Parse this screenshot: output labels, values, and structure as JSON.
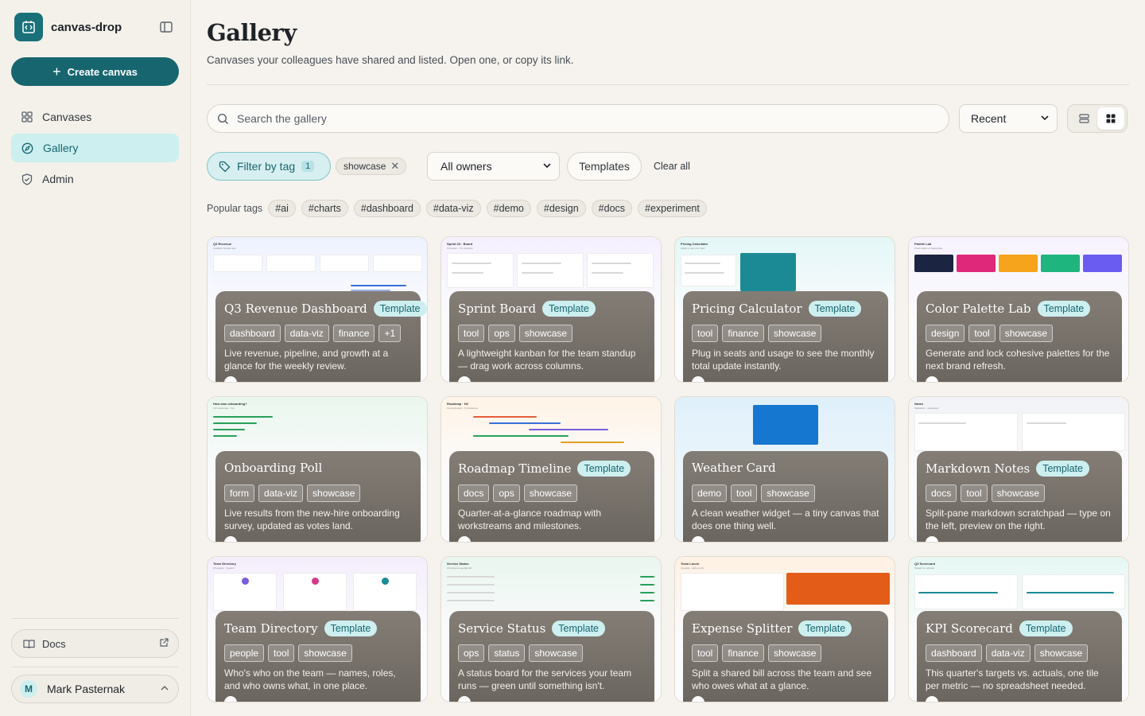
{
  "app": {
    "name": "canvas-drop"
  },
  "sidebar": {
    "create_label": "Create canvas",
    "items": [
      {
        "label": "Canvases",
        "icon": "grid-icon"
      },
      {
        "label": "Gallery",
        "icon": "compass-icon"
      },
      {
        "label": "Admin",
        "icon": "shield-icon"
      }
    ],
    "docs_label": "Docs",
    "user": {
      "initial": "M",
      "name": "Mark Pasternak"
    }
  },
  "header": {
    "title": "Gallery",
    "subtitle": "Canvases your colleagues have shared and listed. Open one, or copy its link."
  },
  "search": {
    "placeholder": "Search the gallery",
    "value": ""
  },
  "sort": {
    "selected": "Recent"
  },
  "filters": {
    "tag_button": "Filter by tag",
    "tag_count": "1",
    "active_tag": "showcase",
    "owners": "All owners",
    "templates": "Templates",
    "clear": "Clear all"
  },
  "popular": {
    "label": "Popular tags",
    "tags": [
      "#ai",
      "#charts",
      "#dashboard",
      "#data-viz",
      "#demo",
      "#design",
      "#docs",
      "#experiment"
    ]
  },
  "template_label": "Template",
  "cards": [
    {
      "title": "Q3 Revenue Dashboard",
      "template": true,
      "tags": [
        "dashboard",
        "data-viz",
        "finance",
        "+1"
      ],
      "desc": "Live revenue, pipeline, and growth at a glance for the weekly review.",
      "pv_title": "Q3 Revenue",
      "pv_sub": "Updated minutes ago"
    },
    {
      "title": "Sprint Board",
      "template": true,
      "tags": [
        "tool",
        "ops",
        "showcase"
      ],
      "desc": "A lightweight kanban for the team standup — drag work across columns.",
      "pv_title": "Sprint 24 · Board",
      "pv_sub": "12 issues · 4 in progress"
    },
    {
      "title": "Pricing Calculator",
      "template": true,
      "tags": [
        "tool",
        "finance",
        "showcase"
      ],
      "desc": "Plug in seats and usage to see the monthly total update instantly.",
      "pv_title": "Pricing Calculator",
      "pv_sub": "Adjust to see your plan"
    },
    {
      "title": "Color Palette Lab",
      "template": true,
      "tags": [
        "design",
        "tool",
        "showcase"
      ],
      "desc": "Generate and lock cohesive palettes for the next brand refresh.",
      "pv_title": "Palette Lab",
      "pv_sub": "Press space to regenerate"
    },
    {
      "title": "Onboarding Poll",
      "template": false,
      "tags": [
        "form",
        "data-viz",
        "showcase"
      ],
      "desc": "Live results from the new-hire onboarding survey, updated as votes land.",
      "pv_title": "How was onboarding?",
      "pv_sub": "142 responses · live"
    },
    {
      "title": "Roadmap Timeline",
      "template": true,
      "tags": [
        "docs",
        "ops",
        "showcase"
      ],
      "desc": "Quarter-at-a-glance roadmap with workstreams and milestones.",
      "pv_title": "Roadmap · H2",
      "pv_sub": "4 workstreams · 6 milestones"
    },
    {
      "title": "Weather Card",
      "template": false,
      "tags": [
        "demo",
        "tool",
        "showcase"
      ],
      "desc": "A clean weather widget — a tiny canvas that does one thing well.",
      "pv_title": "",
      "pv_sub": ""
    },
    {
      "title": "Markdown Notes",
      "template": true,
      "tags": [
        "docs",
        "tool",
        "showcase"
      ],
      "desc": "Split-pane markdown scratchpad — type on the left, preview on the right.",
      "pv_title": "Notes",
      "pv_sub": "Markdown · autosaved"
    },
    {
      "title": "Team Directory",
      "template": true,
      "tags": [
        "people",
        "tool",
        "showcase"
      ],
      "desc": "Who's who on the team — names, roles, and who owns what, in one place.",
      "pv_title": "Team Directory",
      "pv_sub": "18 people · 4 teams"
    },
    {
      "title": "Service Status",
      "template": true,
      "tags": [
        "ops",
        "status",
        "showcase"
      ],
      "desc": "A status board for the services your team runs — green until something isn't.",
      "pv_title": "Service Status",
      "pv_sub": "All systems operational"
    },
    {
      "title": "Expense Splitter",
      "template": true,
      "tags": [
        "tool",
        "finance",
        "showcase"
      ],
      "desc": "Split a shared bill across the team and see who owes what at a glance.",
      "pv_title": "Team Lunch",
      "pv_sub": "4 people · split evenly"
    },
    {
      "title": "KPI Scorecard",
      "template": true,
      "tags": [
        "dashboard",
        "data-viz",
        "showcase"
      ],
      "desc": "This quarter's targets vs. actuals, one tile per metric — no spreadsheet needed.",
      "pv_title": "Q3 Scorecard",
      "pv_sub": "Targets vs. actuals"
    }
  ],
  "colors": {
    "accent": "#17666f",
    "accent_soft": "#cdeff0",
    "background": "#f6f3ee"
  }
}
